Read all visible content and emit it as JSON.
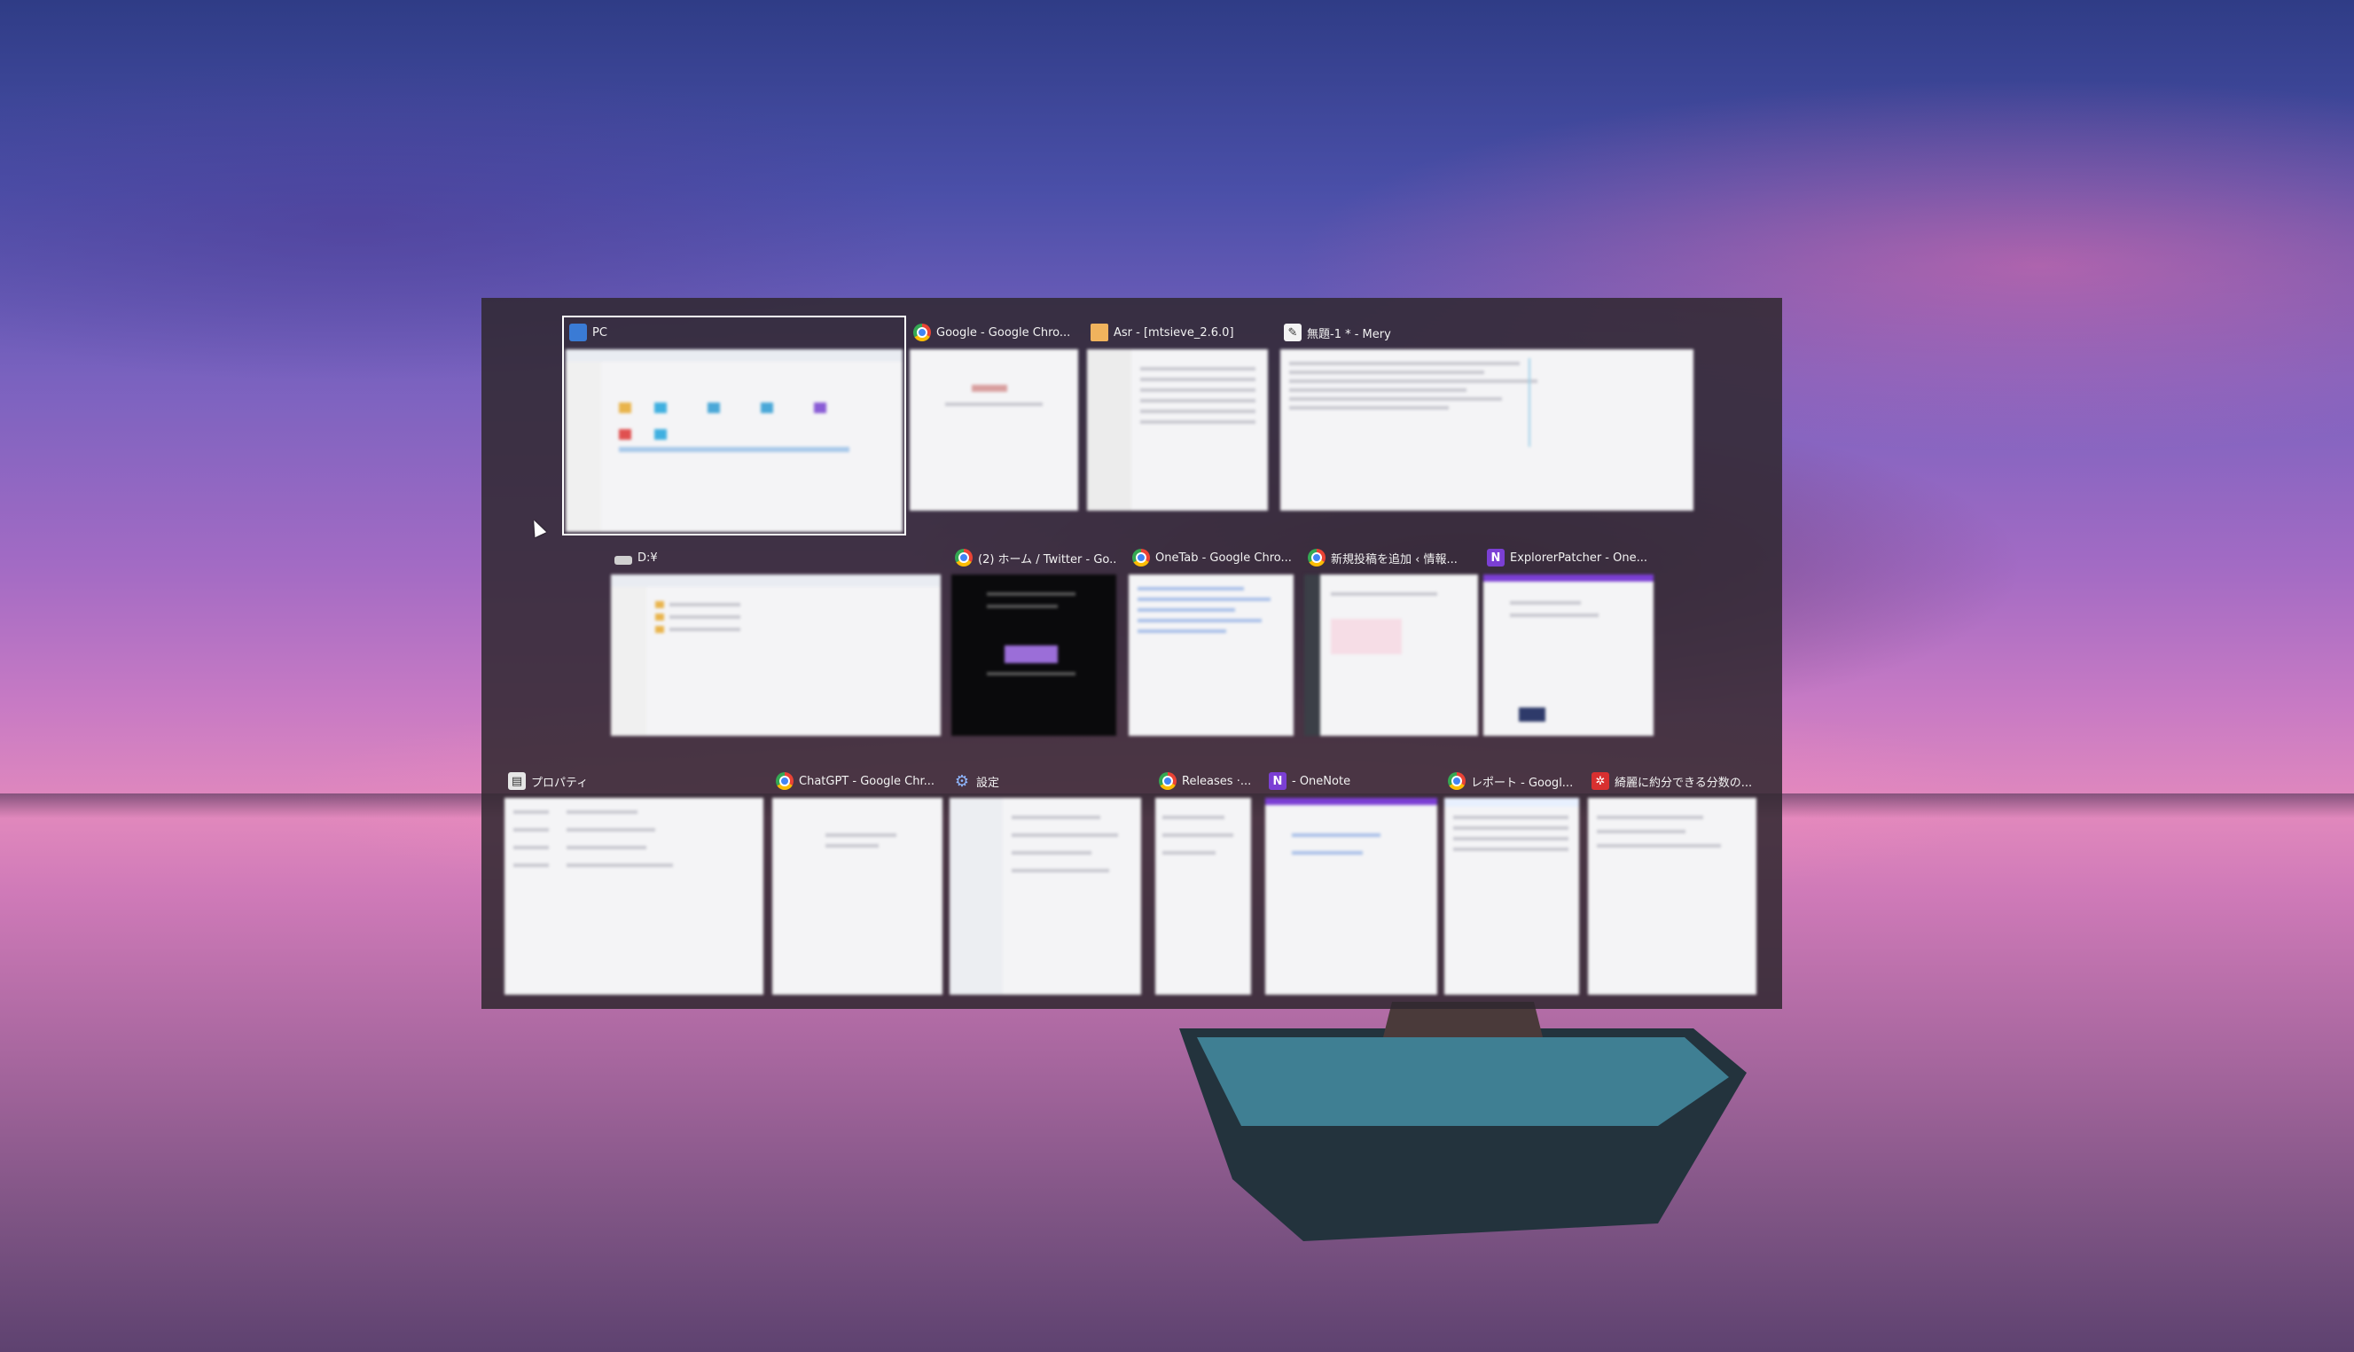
{
  "switcher": {
    "windows": [
      {
        "title": "PC",
        "icon": "this-pc-icon",
        "selected": true,
        "theme": "explorer"
      },
      {
        "title": "Google - Google Chro...",
        "icon": "chrome-icon",
        "selected": false,
        "theme": "blank"
      },
      {
        "title": "Asr - [mtsieve_2.6.0]",
        "icon": "folder-icon",
        "selected": false,
        "theme": "list"
      },
      {
        "title": "無題-1 * - Mery",
        "icon": "mery-icon",
        "selected": false,
        "theme": "editor"
      },
      {
        "title": "D:¥",
        "icon": "drive-icon",
        "selected": false,
        "theme": "explorer"
      },
      {
        "title": "(2) ホーム / Twitter - Go...",
        "icon": "chrome-icon",
        "selected": false,
        "theme": "dark"
      },
      {
        "title": "OneTab - Google Chro...",
        "icon": "chrome-icon",
        "selected": false,
        "theme": "text"
      },
      {
        "title": "新規投稿を追加 ‹ 情報...",
        "icon": "chrome-icon",
        "selected": false,
        "theme": "wp"
      },
      {
        "title": "ExplorerPatcher - One...",
        "icon": "onenote-icon",
        "selected": false,
        "theme": "onenote"
      },
      {
        "title": "プロパティ",
        "icon": "properties-icon",
        "selected": false,
        "theme": "props"
      },
      {
        "title": "ChatGPT - Google Chr...",
        "icon": "chrome-icon",
        "selected": false,
        "theme": "blank"
      },
      {
        "title": "設定",
        "icon": "settings-icon",
        "selected": false,
        "theme": "settings"
      },
      {
        "title": "Releases ·...",
        "icon": "chrome-icon",
        "selected": false,
        "theme": "text"
      },
      {
        "title": "- OneNote",
        "icon": "onenote-icon",
        "selected": false,
        "theme": "onenote"
      },
      {
        "title": "レポート - Googl...",
        "icon": "chrome-icon",
        "selected": false,
        "theme": "sheet"
      },
      {
        "title": "綺麗に約分できる分数の...",
        "icon": "app-red-icon",
        "selected": false,
        "theme": "text"
      }
    ]
  },
  "colors": {
    "switcher_bg": "#302830",
    "selection": "#ffffff",
    "title_text": "#f2f2f2"
  }
}
